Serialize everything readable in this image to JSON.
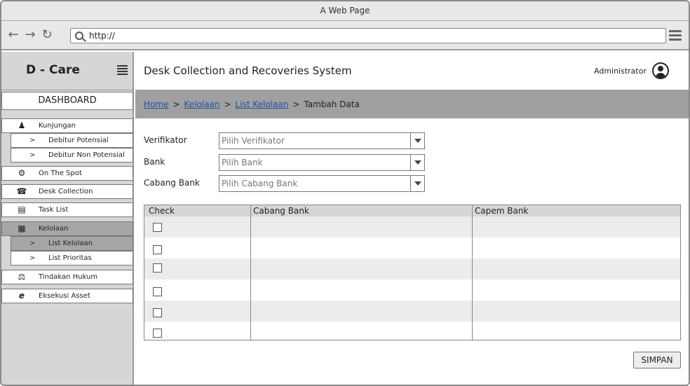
{
  "browser": {
    "title": "A Web Page",
    "url": "http://"
  },
  "sidebar": {
    "brand": "D - Care",
    "dashboard": "DASHBOARD",
    "items": [
      {
        "label": "Kunjungan",
        "icon": "users-icon"
      },
      {
        "label": "On The Spot",
        "icon": "gear-icon"
      },
      {
        "label": "Desk Collection",
        "icon": "phone-icon"
      },
      {
        "label": "Task List",
        "icon": "document-icon"
      },
      {
        "label": "Kelolaan",
        "icon": "building-icon"
      },
      {
        "label": "Tindakan Hukum",
        "icon": "scales-icon"
      },
      {
        "label": "Eksekusi Asset",
        "icon": "internet-explorer-icon"
      }
    ],
    "kunjungan_sub": [
      "Debitur Potensial",
      "Debitur Non Potensial"
    ],
    "kelolaan_sub": [
      "List Kelolaan",
      "List Prioritas"
    ]
  },
  "header": {
    "title": "Desk Collection and Recoveries System",
    "user": "Administrator"
  },
  "breadcrumb": {
    "home": "Home",
    "kelolaan": "Kelolaan",
    "list": "List Kelolaan",
    "current": "Tambah Data",
    "sep": ">"
  },
  "form": {
    "verifikator_label": "Verifikator",
    "verifikator_placeholder": "Pilih Verifikator",
    "bank_label": "Bank",
    "bank_placeholder": "Pilih Bank",
    "cabang_label": "Cabang Bank",
    "cabang_placeholder": "Pilih Cabang Bank"
  },
  "table": {
    "columns": [
      "Check",
      "Cabang Bank",
      "Capem Bank"
    ],
    "rows": 6
  },
  "actions": {
    "save": "SIMPAN"
  }
}
